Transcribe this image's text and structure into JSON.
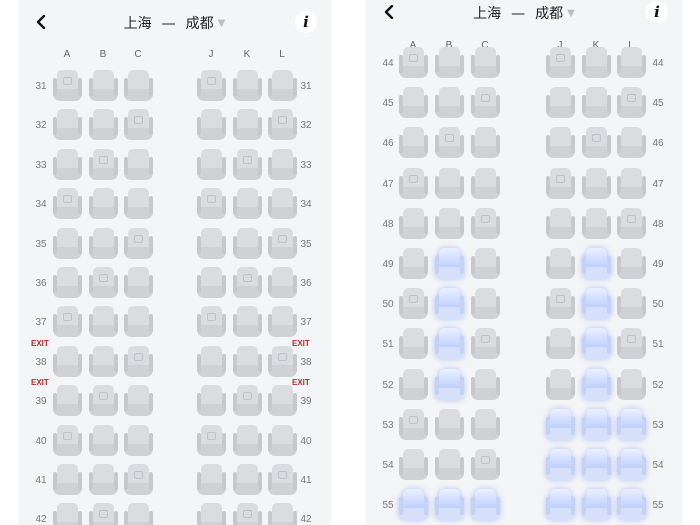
{
  "left": {
    "header": {
      "origin": "上海",
      "separator": "—",
      "destination": "成都"
    },
    "columns_left": [
      "A",
      "B",
      "C"
    ],
    "columns_right": [
      "J",
      "K",
      "L"
    ],
    "rows": [
      {
        "number": "31",
        "seats": [
          "taken",
          "taken",
          "taken",
          "taken",
          "taken",
          "taken"
        ]
      },
      {
        "number": "32",
        "seats": [
          "taken",
          "taken",
          "taken",
          "taken",
          "taken",
          "taken"
        ]
      },
      {
        "number": "33",
        "seats": [
          "taken",
          "taken",
          "taken",
          "taken",
          "taken",
          "taken"
        ]
      },
      {
        "number": "34",
        "seats": [
          "taken",
          "taken",
          "taken",
          "taken",
          "taken",
          "taken"
        ]
      },
      {
        "number": "35",
        "seats": [
          "taken",
          "taken",
          "taken",
          "taken",
          "taken",
          "taken"
        ]
      },
      {
        "number": "36",
        "seats": [
          "taken",
          "taken",
          "taken",
          "taken",
          "taken",
          "taken"
        ]
      },
      {
        "number": "37",
        "seats": [
          "taken",
          "taken",
          "taken",
          "taken",
          "taken",
          "taken"
        ]
      },
      {
        "number": "38",
        "seats": [
          "taken",
          "taken",
          "taken",
          "taken",
          "taken",
          "taken"
        ]
      },
      {
        "number": "39",
        "seats": [
          "taken",
          "taken",
          "taken",
          "taken",
          "taken",
          "taken"
        ]
      },
      {
        "number": "40",
        "seats": [
          "taken",
          "taken",
          "taken",
          "taken",
          "taken",
          "taken"
        ]
      },
      {
        "number": "41",
        "seats": [
          "taken",
          "taken",
          "taken",
          "taken",
          "taken",
          "taken"
        ]
      },
      {
        "number": "42",
        "seats": [
          "taken",
          "taken",
          "taken",
          "taken",
          "taken",
          "taken"
        ]
      }
    ],
    "exit_label": "EXIT"
  },
  "right": {
    "header": {
      "origin": "上海",
      "separator": "—",
      "destination": "成都"
    },
    "columns_left": [
      "A",
      "B",
      "C"
    ],
    "columns_right": [
      "J",
      "K",
      "L"
    ],
    "rows": [
      {
        "number": "44",
        "seats": [
          "taken",
          "taken",
          "taken",
          "taken",
          "taken",
          "taken"
        ]
      },
      {
        "number": "45",
        "seats": [
          "taken",
          "taken",
          "taken",
          "taken",
          "taken",
          "taken"
        ]
      },
      {
        "number": "46",
        "seats": [
          "taken",
          "taken",
          "taken",
          "taken",
          "taken",
          "taken"
        ]
      },
      {
        "number": "47",
        "seats": [
          "taken",
          "taken",
          "taken",
          "taken",
          "taken",
          "taken"
        ]
      },
      {
        "number": "48",
        "seats": [
          "taken",
          "taken",
          "taken",
          "taken",
          "taken",
          "taken"
        ]
      },
      {
        "number": "49",
        "seats": [
          "taken",
          "available",
          "taken",
          "taken",
          "available",
          "taken"
        ]
      },
      {
        "number": "50",
        "seats": [
          "taken",
          "available",
          "taken",
          "taken",
          "available",
          "taken"
        ]
      },
      {
        "number": "51",
        "seats": [
          "taken",
          "available",
          "taken",
          "taken",
          "available",
          "taken"
        ]
      },
      {
        "number": "52",
        "seats": [
          "taken",
          "available",
          "taken",
          "taken",
          "available",
          "taken"
        ]
      },
      {
        "number": "53",
        "seats": [
          "taken",
          "taken",
          "taken",
          "available",
          "available",
          "available"
        ]
      },
      {
        "number": "54",
        "seats": [
          "taken",
          "taken",
          "taken",
          "available",
          "available",
          "available"
        ]
      },
      {
        "number": "55",
        "seats": [
          "available",
          "available",
          "available",
          "available",
          "available",
          "available"
        ]
      }
    ]
  },
  "colors": {
    "available": "#b8cbfb",
    "taken": "#d6d8db",
    "exit": "#c0262d",
    "background": "#f4f5f7"
  },
  "icons": {
    "back": "chevron-left-icon",
    "info": "info-icon",
    "dropdown": "chevron-down-icon"
  }
}
